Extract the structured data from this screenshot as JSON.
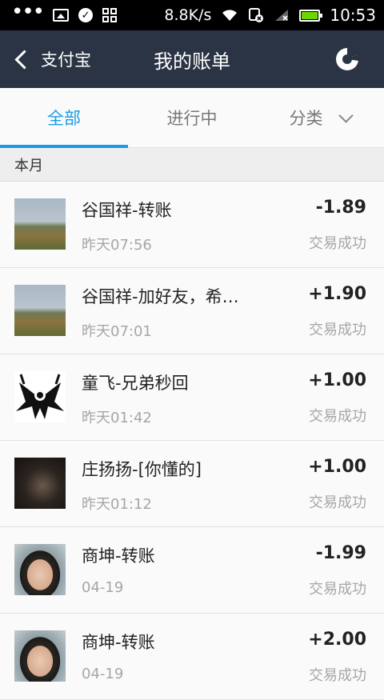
{
  "status_bar": {
    "speed": "8.8K/s",
    "time": "10:53",
    "battery_color": "#6ad700"
  },
  "header": {
    "back_label": "支付宝",
    "title": "我的账单",
    "right_icon": "pie-chart-icon"
  },
  "tabs": [
    {
      "label": "全部",
      "active": true
    },
    {
      "label": "进行中",
      "active": false
    },
    {
      "label": "分类",
      "active": false
    }
  ],
  "section": {
    "label": "本月"
  },
  "transactions": [
    {
      "title": "谷国祥-转账",
      "time": "昨天07:56",
      "amount": "-1.89",
      "status": "交易成功",
      "avatar": "landscape-photo"
    },
    {
      "title": "谷国祥-加好友，希…",
      "time": "昨天07:01",
      "amount": "+1.90",
      "status": "交易成功",
      "avatar": "landscape-photo"
    },
    {
      "title": "童飞-兄弟秒回",
      "time": "昨天01:42",
      "amount": "+1.00",
      "status": "交易成功",
      "avatar": "ink-art"
    },
    {
      "title": "庄扬扬-[你懂的]",
      "time": "昨天01:12",
      "amount": "+1.00",
      "status": "交易成功",
      "avatar": "dark-photo"
    },
    {
      "title": "商坤-转账",
      "time": "04-19",
      "amount": "-1.99",
      "status": "交易成功",
      "avatar": "face-photo"
    },
    {
      "title": "商坤-转账",
      "time": "04-19",
      "amount": "+2.00",
      "status": "交易成功",
      "avatar": "face-photo"
    }
  ],
  "colors": {
    "accent": "#1a9be6",
    "header_bg": "#2b3444"
  }
}
